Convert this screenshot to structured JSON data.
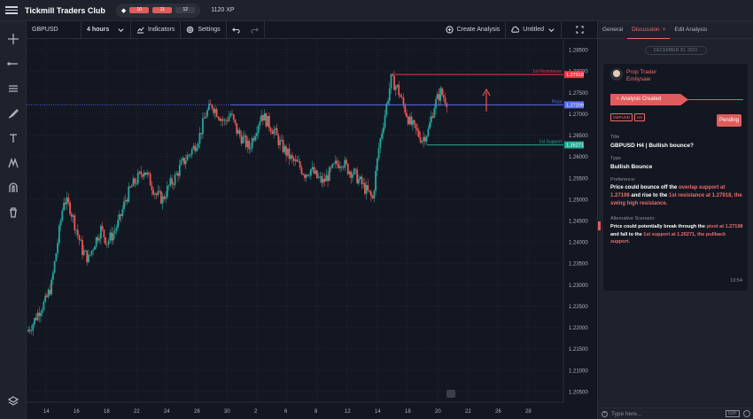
{
  "topbar": {
    "brand": "Tickmill Traders Club",
    "level_segments": [
      "10",
      "11",
      "12"
    ],
    "xp": "1120 XP"
  },
  "toolbar": {
    "symbol": "GBPUSD",
    "interval": "4 hours",
    "indicators": "Indicators",
    "settings": "Settings",
    "create_analysis": "Create Analysis",
    "layout_name": "Untitled"
  },
  "left_tools": [
    "crosshair-icon",
    "trend-line-icon",
    "fib-icon",
    "brush-icon",
    "text-icon",
    "pattern-icon",
    "magnet-icon",
    "trash-icon",
    "layers-icon"
  ],
  "chart": {
    "price_ticks": [
      "1.28500",
      "1.28000",
      "1.27500",
      "1.27000",
      "1.26500",
      "1.26000",
      "1.25500",
      "1.25000",
      "1.24500",
      "1.24000",
      "1.23500",
      "1.23000",
      "1.22500",
      "1.22000",
      "1.21500",
      "1.21000",
      "1.20500"
    ],
    "date_ticks": [
      "14",
      "16",
      "18",
      "22",
      "24",
      "28",
      "30",
      "2",
      "6",
      "8",
      "12",
      "14",
      "18",
      "20",
      "22",
      "26",
      "28"
    ],
    "lines": [
      {
        "label": "1st Resistance",
        "price": "1.27918",
        "color": "#f23645"
      },
      {
        "label": "Pivot",
        "price": "1.27209",
        "color": "#5b6cf0"
      },
      {
        "label": "1st Support",
        "price": "1.26271",
        "color": "#22ab94"
      }
    ]
  },
  "chart_data": {
    "type": "candlestick",
    "symbol": "GBPUSD",
    "interval": "4 hours",
    "ylim": [
      1.2025,
      1.2875
    ],
    "levels": [
      {
        "name": "1st Resistance",
        "value": 1.27918
      },
      {
        "name": "Pivot",
        "value": 1.27209
      },
      {
        "name": "1st Support",
        "value": 1.26271
      }
    ],
    "close_path": [
      1.219,
      1.221,
      1.224,
      1.226,
      1.23,
      1.24,
      1.25,
      1.248,
      1.243,
      1.238,
      1.236,
      1.24,
      1.243,
      1.24,
      1.242,
      1.245,
      1.25,
      1.253,
      1.255,
      1.257,
      1.254,
      1.251,
      1.25,
      1.253,
      1.255,
      1.258,
      1.26,
      1.262,
      1.265,
      1.27,
      1.272,
      1.27,
      1.268,
      1.27,
      1.266,
      1.264,
      1.262,
      1.266,
      1.27,
      1.268,
      1.266,
      1.263,
      1.261,
      1.259,
      1.258,
      1.256,
      1.257,
      1.255,
      1.254,
      1.256,
      1.258,
      1.259,
      1.257,
      1.256,
      1.254,
      1.252,
      1.25,
      1.262,
      1.27,
      1.278,
      1.276,
      1.272,
      1.268,
      1.266,
      1.264,
      1.266,
      1.272,
      1.275,
      1.273
    ]
  },
  "panel": {
    "tabs": [
      {
        "label": "General"
      },
      {
        "label": "Discussion"
      },
      {
        "label": "Edit Analysis"
      }
    ],
    "date_pill": "DECEMBER 20, 2023",
    "author_role": "Prop Trader",
    "author_name": "Emilysaw",
    "created_label": "Analysis Created",
    "tags": [
      "GBPUSD",
      "H4"
    ],
    "status": "Pending",
    "title_label": "Title",
    "title_value": "GBPUSD H4 | Bullish bounce?",
    "type_label": "Type",
    "type_value": "Bullish Bounce",
    "pref_label": "Preference:",
    "pref_parts": [
      "Price could bounce off the ",
      "overlap support at 1.27198",
      " and rise to the ",
      "1st resistance at 1.27918, the swing high resistance."
    ],
    "alt_label": "Alternative Scenario:",
    "alt_parts": [
      "Price could potentially break through the ",
      "pivot at 1.27198",
      " and fall to the ",
      "1st support at 1.26271, the pullback support."
    ],
    "time": "13:54",
    "input_placeholder": "Type here...",
    "gif_label": "GIF"
  }
}
